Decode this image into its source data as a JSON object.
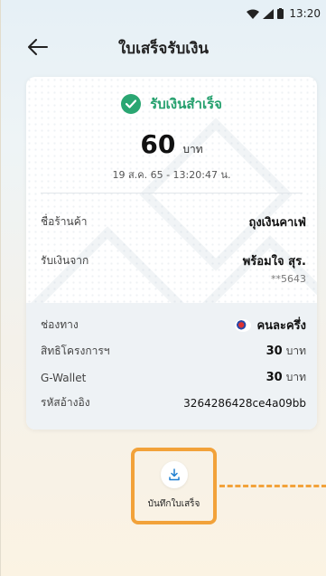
{
  "status_bar": {
    "time": "13:20"
  },
  "header": {
    "title": "ใบเสร็จรับเงิน"
  },
  "receipt": {
    "status": "รับเงินสำเร็จ",
    "amount": "60",
    "amount_unit": "บาท",
    "datetime": "19 ส.ค. 65 - 13:20:47 น.",
    "merchant_label": "ชื่อร้านค้า",
    "merchant_value": "ถุงเงินคาเฟ่",
    "payer_label": "รับเงินจาก",
    "payer_value": "พร้อมใจ สุร.",
    "payer_account": "**5643",
    "channel_label": "ช่องทาง",
    "channel_value": "คนละครึ่ง",
    "entitlement_label": "สิทธิโครงการฯ",
    "entitlement_value": "30",
    "entitlement_unit": "บาท",
    "gwallet_label": "G-Wallet",
    "gwallet_value": "30",
    "gwallet_unit": "บาท",
    "ref_label": "รหัสอ้างอิง",
    "ref_value": "3264286428ce4a09bb"
  },
  "actions": {
    "save_label": "บันทึกใบเสร็จ"
  },
  "colors": {
    "success": "#24a06d",
    "highlight": "#f2a23a"
  }
}
